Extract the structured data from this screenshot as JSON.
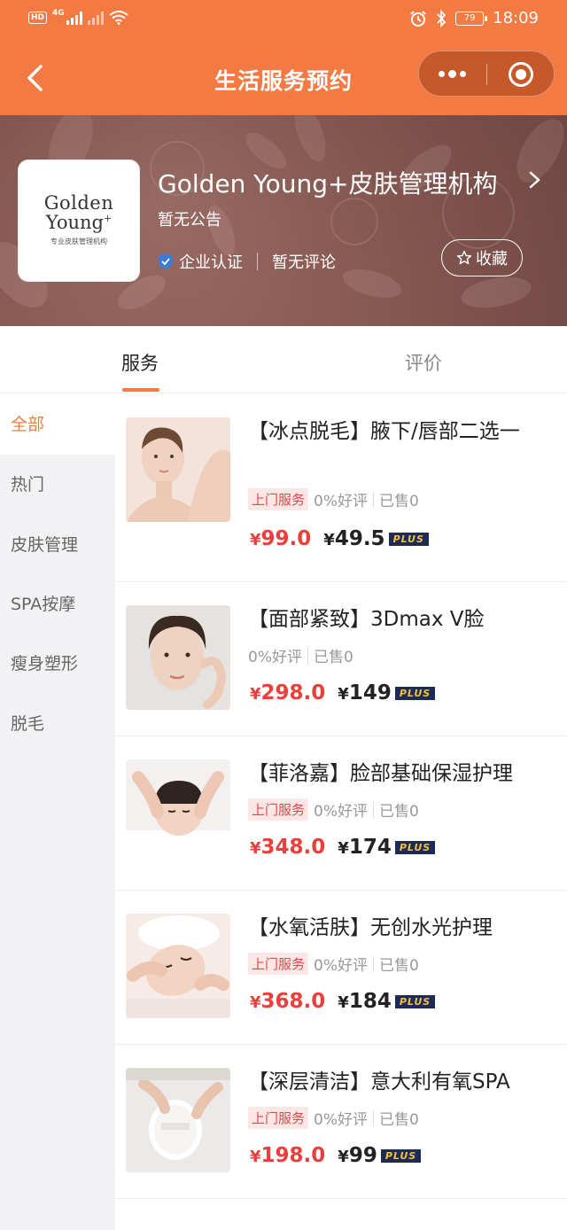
{
  "status_bar": {
    "hd": "HD",
    "network": "4G",
    "time": "18:09",
    "battery": "79"
  },
  "nav": {
    "title": "生活服务预约"
  },
  "shop": {
    "logo_line1": "Golden",
    "logo_line2": "Young",
    "logo_plus": "+",
    "logo_sub": "专业皮肤管理机构",
    "name": "Golden Young+皮肤管理机构",
    "notice": "暂无公告",
    "cert": "企业认证",
    "review": "暂无评论",
    "favorite": "收藏"
  },
  "tabs": [
    "服务",
    "评价"
  ],
  "categories": [
    "全部",
    "热门",
    "皮肤管理",
    "SPA按摩",
    "瘦身塑形",
    "脱毛"
  ],
  "products": [
    {
      "title": "【冰点脱毛】腋下/唇部二选一",
      "tag": "上门服务",
      "rating": "0%好评",
      "sold": "已售0",
      "price": "99.0",
      "plus_price": "49.5"
    },
    {
      "title": "【面部紧致】3Dmax V脸",
      "tag": "",
      "rating": "0%好评",
      "sold": "已售0",
      "price": "298.0",
      "plus_price": "149"
    },
    {
      "title": "【菲洛嘉】脸部基础保湿护理",
      "tag": "上门服务",
      "rating": "0%好评",
      "sold": "已售0",
      "price": "348.0",
      "plus_price": "174"
    },
    {
      "title": "【水氧活肤】无创水光护理",
      "tag": "上门服务",
      "rating": "0%好评",
      "sold": "已售0",
      "price": "368.0",
      "plus_price": "184"
    },
    {
      "title": "【深层清洁】意大利有氧SPA",
      "tag": "上门服务",
      "rating": "0%好评",
      "sold": "已售0",
      "price": "198.0",
      "plus_price": "99"
    }
  ],
  "currency": "¥",
  "plus_label": "PLUS",
  "colors": {
    "brand": "#f47a44",
    "price": "#e8403c",
    "plus_bg": "#1d2b55",
    "plus_text": "#f3c141"
  }
}
